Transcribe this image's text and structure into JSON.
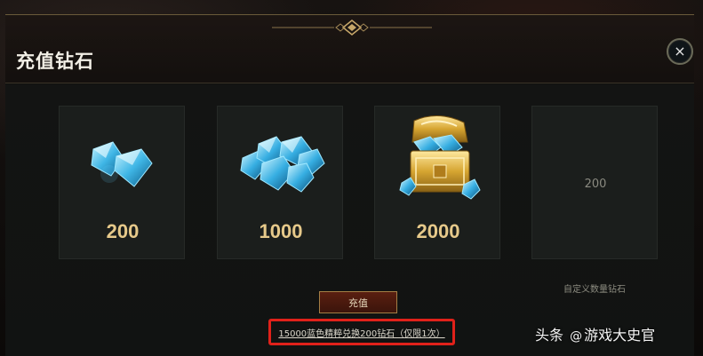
{
  "modal": {
    "title": "充值钻石",
    "close_label": "×"
  },
  "cards": [
    {
      "amount": "200",
      "icon": "diamond-small-icon"
    },
    {
      "amount": "1000",
      "icon": "diamond-pile-icon"
    },
    {
      "amount": "2000",
      "icon": "diamond-chest-icon"
    }
  ],
  "custom_card": {
    "value": "200",
    "label": "自定义数量钻石"
  },
  "actions": {
    "recharge_label": "充值",
    "exchange_link": "15000蓝色精粹兑换200钻石（仅限1次）"
  },
  "watermark": {
    "brand": "头条",
    "at": "@",
    "account": "游戏大史官"
  },
  "colors": {
    "accent_gold": "#e6c98a",
    "highlight_red": "#e0211a"
  }
}
